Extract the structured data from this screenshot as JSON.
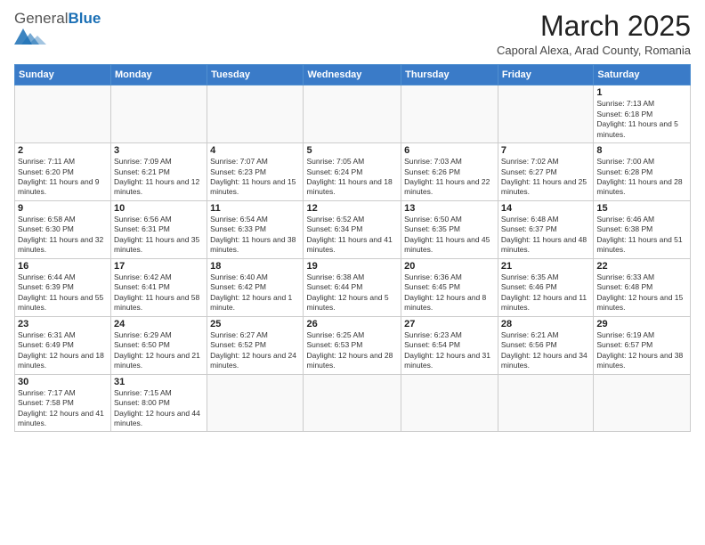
{
  "header": {
    "logo_general": "General",
    "logo_blue": "Blue",
    "month_title": "March 2025",
    "subtitle": "Caporal Alexa, Arad County, Romania"
  },
  "days_of_week": [
    "Sunday",
    "Monday",
    "Tuesday",
    "Wednesday",
    "Thursday",
    "Friday",
    "Saturday"
  ],
  "weeks": [
    [
      {
        "day": "",
        "info": ""
      },
      {
        "day": "",
        "info": ""
      },
      {
        "day": "",
        "info": ""
      },
      {
        "day": "",
        "info": ""
      },
      {
        "day": "",
        "info": ""
      },
      {
        "day": "",
        "info": ""
      },
      {
        "day": "1",
        "info": "Sunrise: 7:13 AM\nSunset: 6:18 PM\nDaylight: 11 hours and 5 minutes."
      }
    ],
    [
      {
        "day": "2",
        "info": "Sunrise: 7:11 AM\nSunset: 6:20 PM\nDaylight: 11 hours and 9 minutes."
      },
      {
        "day": "3",
        "info": "Sunrise: 7:09 AM\nSunset: 6:21 PM\nDaylight: 11 hours and 12 minutes."
      },
      {
        "day": "4",
        "info": "Sunrise: 7:07 AM\nSunset: 6:23 PM\nDaylight: 11 hours and 15 minutes."
      },
      {
        "day": "5",
        "info": "Sunrise: 7:05 AM\nSunset: 6:24 PM\nDaylight: 11 hours and 18 minutes."
      },
      {
        "day": "6",
        "info": "Sunrise: 7:03 AM\nSunset: 6:26 PM\nDaylight: 11 hours and 22 minutes."
      },
      {
        "day": "7",
        "info": "Sunrise: 7:02 AM\nSunset: 6:27 PM\nDaylight: 11 hours and 25 minutes."
      },
      {
        "day": "8",
        "info": "Sunrise: 7:00 AM\nSunset: 6:28 PM\nDaylight: 11 hours and 28 minutes."
      }
    ],
    [
      {
        "day": "9",
        "info": "Sunrise: 6:58 AM\nSunset: 6:30 PM\nDaylight: 11 hours and 32 minutes."
      },
      {
        "day": "10",
        "info": "Sunrise: 6:56 AM\nSunset: 6:31 PM\nDaylight: 11 hours and 35 minutes."
      },
      {
        "day": "11",
        "info": "Sunrise: 6:54 AM\nSunset: 6:33 PM\nDaylight: 11 hours and 38 minutes."
      },
      {
        "day": "12",
        "info": "Sunrise: 6:52 AM\nSunset: 6:34 PM\nDaylight: 11 hours and 41 minutes."
      },
      {
        "day": "13",
        "info": "Sunrise: 6:50 AM\nSunset: 6:35 PM\nDaylight: 11 hours and 45 minutes."
      },
      {
        "day": "14",
        "info": "Sunrise: 6:48 AM\nSunset: 6:37 PM\nDaylight: 11 hours and 48 minutes."
      },
      {
        "day": "15",
        "info": "Sunrise: 6:46 AM\nSunset: 6:38 PM\nDaylight: 11 hours and 51 minutes."
      }
    ],
    [
      {
        "day": "16",
        "info": "Sunrise: 6:44 AM\nSunset: 6:39 PM\nDaylight: 11 hours and 55 minutes."
      },
      {
        "day": "17",
        "info": "Sunrise: 6:42 AM\nSunset: 6:41 PM\nDaylight: 11 hours and 58 minutes."
      },
      {
        "day": "18",
        "info": "Sunrise: 6:40 AM\nSunset: 6:42 PM\nDaylight: 12 hours and 1 minute."
      },
      {
        "day": "19",
        "info": "Sunrise: 6:38 AM\nSunset: 6:44 PM\nDaylight: 12 hours and 5 minutes."
      },
      {
        "day": "20",
        "info": "Sunrise: 6:36 AM\nSunset: 6:45 PM\nDaylight: 12 hours and 8 minutes."
      },
      {
        "day": "21",
        "info": "Sunrise: 6:35 AM\nSunset: 6:46 PM\nDaylight: 12 hours and 11 minutes."
      },
      {
        "day": "22",
        "info": "Sunrise: 6:33 AM\nSunset: 6:48 PM\nDaylight: 12 hours and 15 minutes."
      }
    ],
    [
      {
        "day": "23",
        "info": "Sunrise: 6:31 AM\nSunset: 6:49 PM\nDaylight: 12 hours and 18 minutes."
      },
      {
        "day": "24",
        "info": "Sunrise: 6:29 AM\nSunset: 6:50 PM\nDaylight: 12 hours and 21 minutes."
      },
      {
        "day": "25",
        "info": "Sunrise: 6:27 AM\nSunset: 6:52 PM\nDaylight: 12 hours and 24 minutes."
      },
      {
        "day": "26",
        "info": "Sunrise: 6:25 AM\nSunset: 6:53 PM\nDaylight: 12 hours and 28 minutes."
      },
      {
        "day": "27",
        "info": "Sunrise: 6:23 AM\nSunset: 6:54 PM\nDaylight: 12 hours and 31 minutes."
      },
      {
        "day": "28",
        "info": "Sunrise: 6:21 AM\nSunset: 6:56 PM\nDaylight: 12 hours and 34 minutes."
      },
      {
        "day": "29",
        "info": "Sunrise: 6:19 AM\nSunset: 6:57 PM\nDaylight: 12 hours and 38 minutes."
      }
    ],
    [
      {
        "day": "30",
        "info": "Sunrise: 7:17 AM\nSunset: 7:58 PM\nDaylight: 12 hours and 41 minutes."
      },
      {
        "day": "31",
        "info": "Sunrise: 7:15 AM\nSunset: 8:00 PM\nDaylight: 12 hours and 44 minutes."
      },
      {
        "day": "",
        "info": ""
      },
      {
        "day": "",
        "info": ""
      },
      {
        "day": "",
        "info": ""
      },
      {
        "day": "",
        "info": ""
      },
      {
        "day": "",
        "info": ""
      }
    ]
  ]
}
